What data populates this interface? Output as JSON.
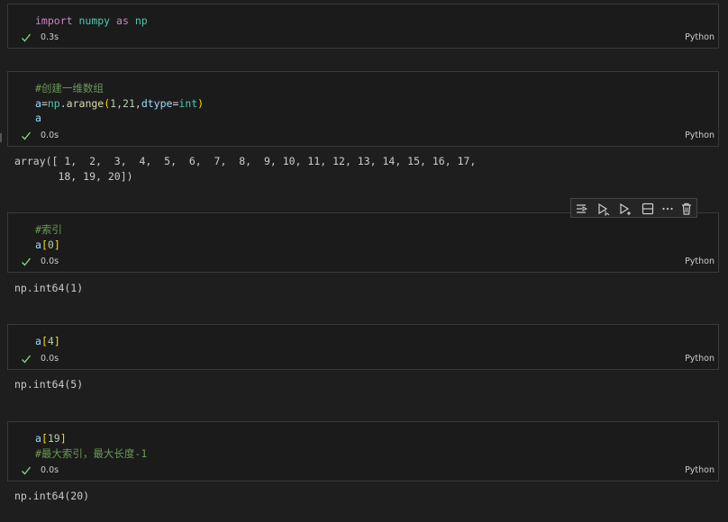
{
  "cells": [
    {
      "exec_time": "0.3s",
      "language": "Python",
      "lines": [
        [
          {
            "t": "import",
            "c": "k-import"
          },
          {
            "t": " "
          },
          {
            "t": "numpy",
            "c": "k-name"
          },
          {
            "t": " "
          },
          {
            "t": "as",
            "c": "k-import"
          },
          {
            "t": " "
          },
          {
            "t": "np",
            "c": "k-name"
          }
        ]
      ]
    },
    {
      "exec_time": "0.0s",
      "language": "Python",
      "lines": [
        [
          {
            "t": "#创建一维数组",
            "c": "k-cmt"
          }
        ],
        [
          {
            "t": "a",
            "c": "k-var"
          },
          {
            "t": "=",
            "c": "k-op"
          },
          {
            "t": "np",
            "c": "k-name"
          },
          {
            "t": ".",
            "c": "k-op"
          },
          {
            "t": "arange",
            "c": "k-fn"
          },
          {
            "t": "(",
            "c": "k-br"
          },
          {
            "t": "1",
            "c": "k-num"
          },
          {
            "t": ",",
            "c": "k-op"
          },
          {
            "t": "21",
            "c": "k-num"
          },
          {
            "t": ",",
            "c": "k-op"
          },
          {
            "t": "dtype",
            "c": "k-var"
          },
          {
            "t": "=",
            "c": "k-op"
          },
          {
            "t": "int",
            "c": "k-name"
          },
          {
            "t": ")",
            "c": "k-br"
          }
        ],
        [
          {
            "t": "a",
            "c": "k-var"
          }
        ]
      ],
      "output": "array([ 1,  2,  3,  4,  5,  6,  7,  8,  9, 10, 11, 12, 13, 14, 15, 16, 17,\n       18, 19, 20])"
    },
    {
      "exec_time": "0.0s",
      "language": "Python",
      "lines": [
        [
          {
            "t": "#索引",
            "c": "k-cmt"
          }
        ],
        [
          {
            "t": "a",
            "c": "k-var"
          },
          {
            "t": "[",
            "c": "k-br"
          },
          {
            "t": "0",
            "c": "k-num"
          },
          {
            "t": "]",
            "c": "k-br"
          }
        ]
      ],
      "output": "np.int64(1)"
    },
    {
      "exec_time": "0.0s",
      "language": "Python",
      "lines": [
        [
          {
            "t": "a",
            "c": "k-var"
          },
          {
            "t": "[",
            "c": "k-br"
          },
          {
            "t": "4",
            "c": "k-num"
          },
          {
            "t": "]",
            "c": "k-br"
          }
        ]
      ],
      "output": "np.int64(5)"
    },
    {
      "exec_time": "0.0s",
      "language": "Python",
      "lines": [
        [
          {
            "t": "a",
            "c": "k-var"
          },
          {
            "t": "[",
            "c": "k-br"
          },
          {
            "t": "19",
            "c": "k-num"
          },
          {
            "t": "]",
            "c": "k-br"
          }
        ],
        [
          {
            "t": "#最大索引，最大长度-1",
            "c": "k-cmt"
          }
        ]
      ],
      "output": "np.int64(20)"
    }
  ],
  "toolbar": {
    "buttons": [
      "execute-above-icon",
      "execute-cell-and-below-icon",
      "execute-and-advance-icon",
      "split-cell-icon",
      "more-actions-icon",
      "delete-cell-icon"
    ]
  },
  "colors": {
    "check": "#89d185",
    "background": "#1e1e1e",
    "cell_background": "#1b1b1b",
    "border": "#3a3a3a"
  }
}
